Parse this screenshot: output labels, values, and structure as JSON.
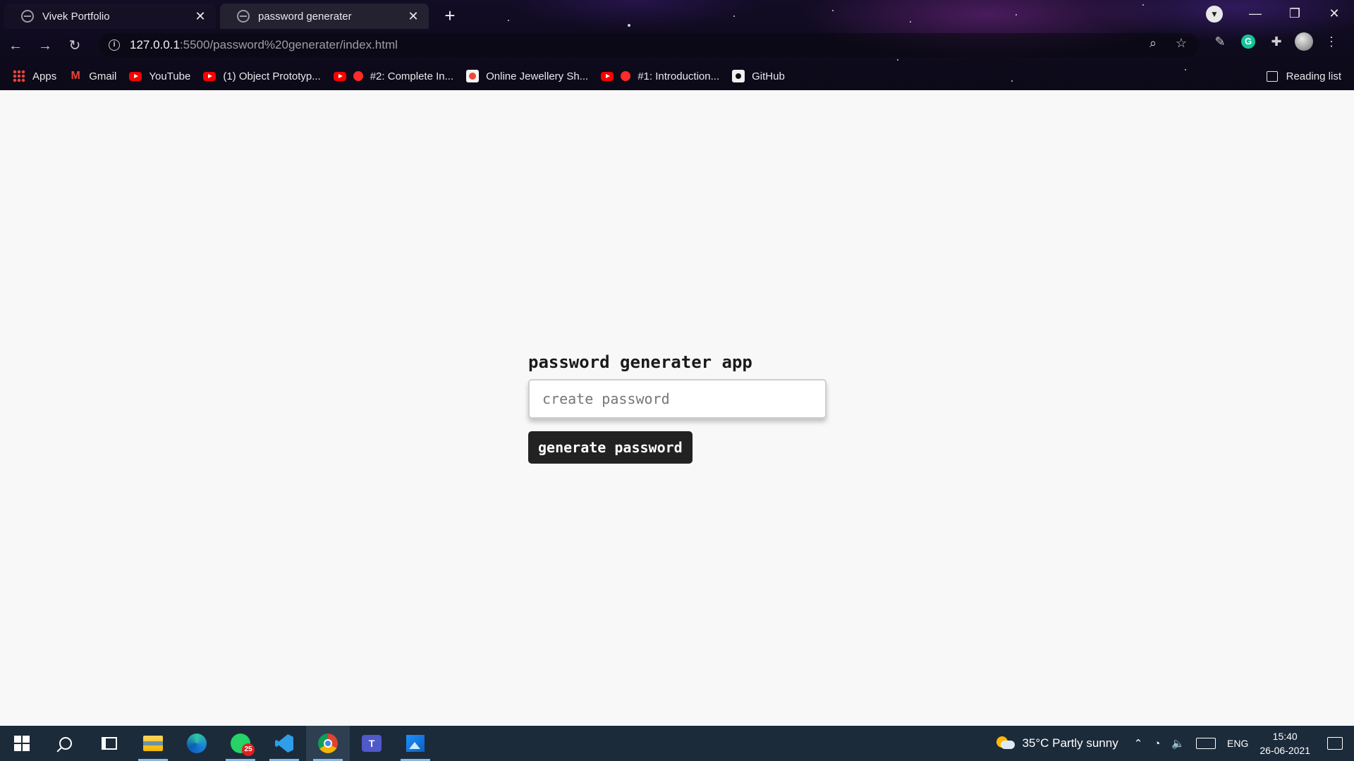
{
  "browser": {
    "tabs": [
      {
        "title": "Vivek Portfolio",
        "active": false
      },
      {
        "title": "password generater",
        "active": true
      }
    ],
    "url_host": "127.0.0.1",
    "url_path": ":5500/password%20generater/index.html",
    "bookmarks": [
      {
        "label": "Apps",
        "icon": "apps-grid-icon"
      },
      {
        "label": "Gmail",
        "icon": "gmail-icon"
      },
      {
        "label": "YouTube",
        "icon": "youtube-icon"
      },
      {
        "label": "(1) Object Prototyp...",
        "icon": "youtube-icon"
      },
      {
        "label": "#2: Complete In...",
        "icon": "youtube-icon"
      },
      {
        "label": "Online Jewellery Sh...",
        "icon": "site-icon"
      },
      {
        "label": "#1: Introduction...",
        "icon": "youtube-icon"
      },
      {
        "label": "GitHub",
        "icon": "github-icon"
      }
    ],
    "reading_list": "Reading list"
  },
  "app": {
    "title": "password generater app",
    "input_placeholder": "create password",
    "input_value": "",
    "button_label": "generate password"
  },
  "taskbar": {
    "whatsapp_badge": "25",
    "weather": "35°C  Partly sunny",
    "language": "ENG",
    "time": "15:40",
    "date": "26-06-2021"
  },
  "colors": {
    "page_bg": "#f8f8f8",
    "button_bg": "#222222",
    "taskbar_bg": "#1c2b3a"
  }
}
